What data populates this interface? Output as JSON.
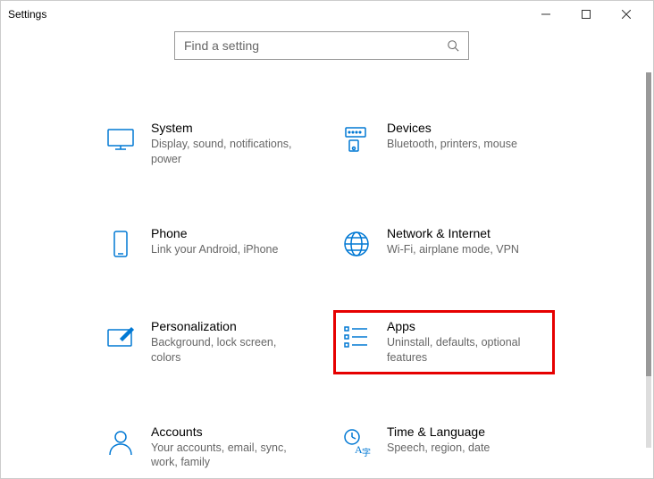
{
  "window": {
    "title": "Settings"
  },
  "search": {
    "placeholder": "Find a setting"
  },
  "tiles": {
    "system": {
      "title": "System",
      "desc": "Display, sound, notifications, power"
    },
    "devices": {
      "title": "Devices",
      "desc": "Bluetooth, printers, mouse"
    },
    "phone": {
      "title": "Phone",
      "desc": "Link your Android, iPhone"
    },
    "network": {
      "title": "Network & Internet",
      "desc": "Wi-Fi, airplane mode, VPN"
    },
    "personalization": {
      "title": "Personalization",
      "desc": "Background, lock screen, colors"
    },
    "apps": {
      "title": "Apps",
      "desc": "Uninstall, defaults, optional features"
    },
    "accounts": {
      "title": "Accounts",
      "desc": "Your accounts, email, sync, work, family"
    },
    "time": {
      "title": "Time & Language",
      "desc": "Speech, region, date"
    }
  }
}
